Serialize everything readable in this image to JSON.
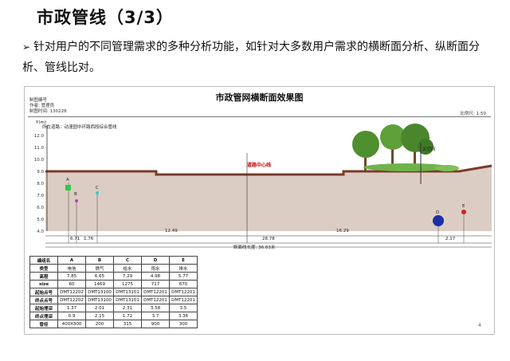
{
  "slide": {
    "title": "市政管线（3/3）",
    "bullet_mark": "➢",
    "bullet_text": "针对用户的不同管理需求的多种分析功能，如针对大多数用户需求的横断面分析、纵断面分析、管线比对。"
  },
  "figure": {
    "title": "市政管网横断面效果图",
    "meta_lines": [
      "制图编号",
      "作者: 管理员",
      "制图时间: 130228"
    ],
    "scale": "比例尺: 1:50",
    "section_label": "所在道路：动漫园中环路西段综合管线",
    "y_axis_label": "Y(m)",
    "y_ticks": [
      "12.0",
      "11.0",
      "10.0",
      "9.0",
      "8.0",
      "7.0",
      "6.0",
      "5.0",
      "4.0"
    ],
    "center_label": "道路中心线",
    "dimensions": [
      "6.71",
      "1.76",
      "12.49",
      "28.78",
      "16.29",
      "2.17"
    ],
    "total_length": "断面线长度: 36.83米",
    "sky_label": "天空网",
    "page_number": "4"
  },
  "pipes": [
    {
      "label": "A",
      "color": "#2ecc40",
      "shape": "square"
    },
    {
      "label": "B",
      "color": "#cc33cc",
      "shape": "dot"
    },
    {
      "label": "C",
      "color": "#33cccc",
      "shape": "dot"
    },
    {
      "label": "D",
      "color": "#1a2ea8",
      "shape": "circle"
    },
    {
      "label": "E",
      "color": "#cc2222",
      "shape": "dot"
    }
  ],
  "table": {
    "header": [
      "编组名",
      "A",
      "B",
      "C",
      "D",
      "E"
    ],
    "rows": [
      [
        "类型",
        "电信",
        "燃气",
        "给水",
        "雨水",
        "排水"
      ],
      [
        "高程",
        "7.85",
        "6.65",
        "7.29",
        "4.98",
        "5.77"
      ],
      [
        "size",
        "60",
        "1469",
        "1275",
        "717",
        "670"
      ],
      [
        "起始点号",
        "DMT12202",
        "DMT13100",
        "DMT13101",
        "DMT12201",
        "DMT12201"
      ],
      [
        "终点点号",
        "DMT12202",
        "DMT13100",
        "DMT13101",
        "DMT12201",
        "DMT12201"
      ],
      [
        "起始埋深",
        "1.37",
        "2.01",
        "2.31",
        "3.58",
        "3.5"
      ],
      [
        "终点埋深",
        "0.9",
        "2.15",
        "1.72",
        "3.7",
        "3.36"
      ],
      [
        "管径",
        "400X300",
        "200",
        "315",
        "900",
        "300"
      ]
    ]
  },
  "colors": {
    "ground": "#dccdc4",
    "road": "#7a3b2a",
    "tree": "#4f8f2f",
    "center_line": "#c00000"
  }
}
